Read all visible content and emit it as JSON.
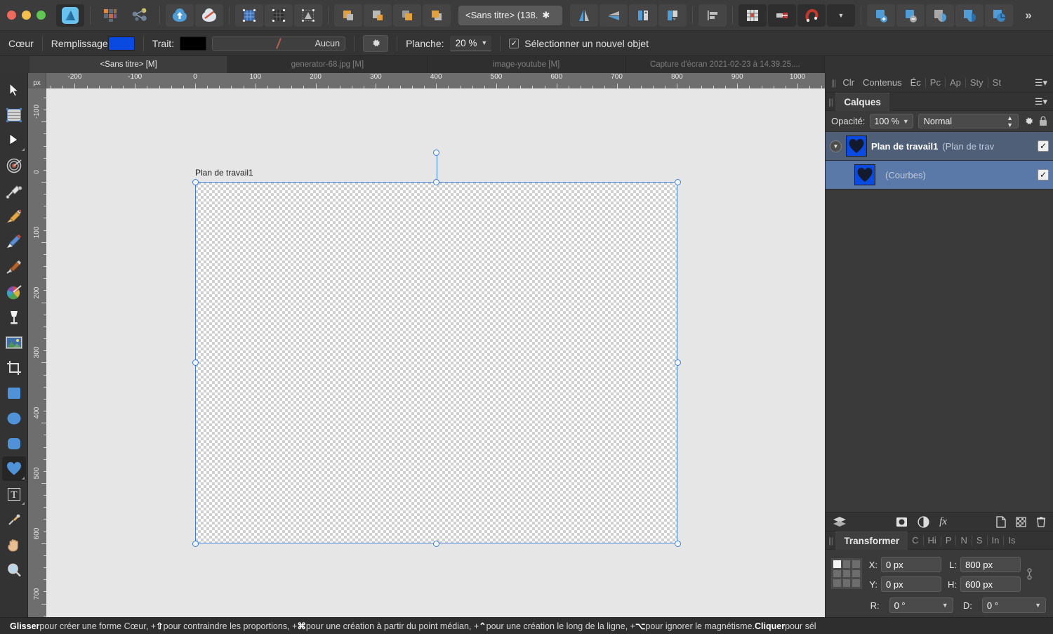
{
  "window": {
    "title": "<Sans titre> (138.",
    "traffic_lights": [
      "close",
      "minimize",
      "zoom"
    ]
  },
  "toolbar": {
    "groups": [
      {
        "name": "app-persona",
        "items": [
          {
            "icon": "affinity-designer-icon",
            "active": true
          }
        ]
      },
      {
        "name": "persona-switch",
        "items": [
          {
            "icon": "pixel-persona-icon"
          },
          {
            "icon": "export-persona-icon"
          }
        ]
      },
      {
        "name": "document",
        "items": [
          {
            "icon": "document-setup-icon"
          },
          {
            "icon": "no-document-icon"
          }
        ]
      },
      {
        "name": "grid",
        "items": [
          {
            "icon": "grid-blue-icon"
          },
          {
            "icon": "grid-dark-icon"
          },
          {
            "icon": "transform-object-icon"
          }
        ]
      },
      {
        "name": "boolean",
        "items": [
          {
            "icon": "add-shapes-icon"
          },
          {
            "icon": "subtract-shapes-icon"
          },
          {
            "icon": "intersect-shapes-icon"
          },
          {
            "icon": "divide-shapes-icon"
          }
        ]
      },
      {
        "name": "flip",
        "items": [
          {
            "icon": "flip-horizontal-icon"
          },
          {
            "icon": "flip-vertical-icon"
          },
          {
            "icon": "rotate-left-icon"
          },
          {
            "icon": "rotate-right-icon"
          }
        ]
      },
      {
        "name": "align",
        "items": [
          {
            "icon": "align-left-icon"
          }
        ]
      },
      {
        "name": "snapping",
        "items": [
          {
            "icon": "show-grid-icon",
            "active": true
          },
          {
            "icon": "snap-guides-icon",
            "active": true
          },
          {
            "icon": "magnet-icon",
            "active": true
          },
          {
            "icon": "chevron-down-icon"
          }
        ]
      },
      {
        "name": "mask",
        "items": [
          {
            "icon": "add-mask-icon"
          },
          {
            "icon": "remove-mask-icon"
          },
          {
            "icon": "adjustment-icon"
          },
          {
            "icon": "pixel-adjust-icon"
          },
          {
            "icon": "live-filter-icon"
          }
        ]
      }
    ],
    "overflow_label": "»"
  },
  "context_bar": {
    "tool_name": "Cœur",
    "fill_label": "Remplissage",
    "fill_color": "#0a4ae0",
    "stroke_label": "Trait:",
    "stroke_color": "#000000",
    "stroke_width_value": "Aucun",
    "settings_icon": "gear-icon",
    "board_label": "Planche:",
    "board_zoom": "20 %",
    "select_new_object_label": "Sélectionner un nouvel objet",
    "select_new_object_checked": true
  },
  "document_tabs": [
    {
      "label": "<Sans titre> [M]",
      "active": true
    },
    {
      "label": "generator-68.jpg [M]",
      "active": false
    },
    {
      "label": "image-youtube [M]",
      "active": false
    },
    {
      "label": "Capture d'écran 2021-02-23 à 14.39.25....",
      "active": false
    }
  ],
  "tools": [
    {
      "name": "move-tool",
      "icon": "⬈",
      "selected": false
    },
    {
      "name": "artboard-tool",
      "icon": "artboard",
      "selected": false
    },
    {
      "name": "node-tool",
      "icon": "▶",
      "selected": false,
      "has_submenu": true
    },
    {
      "name": "corner-tool",
      "icon": "◎",
      "selected": false
    },
    {
      "name": "pen-tool",
      "icon": "pen",
      "selected": false
    },
    {
      "name": "pencil-tool",
      "icon": "fountain-pen",
      "selected": false
    },
    {
      "name": "vector-brush-tool",
      "icon": "pencil",
      "selected": false
    },
    {
      "name": "paint-brush-tool",
      "icon": "brush",
      "selected": false
    },
    {
      "name": "color-wheel-tool",
      "icon": "color-wheel",
      "selected": false
    },
    {
      "name": "fill-tool",
      "icon": "goblet",
      "selected": false
    },
    {
      "name": "place-image-tool",
      "icon": "image",
      "selected": false
    },
    {
      "name": "crop-tool",
      "icon": "crop",
      "selected": false
    },
    {
      "name": "rectangle-tool",
      "icon": "square",
      "selected": false
    },
    {
      "name": "ellipse-tool",
      "icon": "circle",
      "selected": false
    },
    {
      "name": "rounded-rectangle-tool",
      "icon": "rounded-square",
      "selected": false
    },
    {
      "name": "heart-shape-tool",
      "icon": "heart",
      "selected": true,
      "has_submenu": true
    },
    {
      "name": "text-tool",
      "icon": "T",
      "selected": false,
      "has_submenu": true
    },
    {
      "name": "color-picker-tool",
      "icon": "dropper",
      "selected": false
    },
    {
      "name": "hand-tool",
      "icon": "hand",
      "selected": false
    },
    {
      "name": "zoom-tool",
      "icon": "magnifier",
      "selected": false
    }
  ],
  "rulers": {
    "unit": "px",
    "horizontal_labels": [
      -200,
      -100,
      0,
      100,
      200,
      300,
      400,
      500,
      600,
      700,
      800,
      900,
      1000
    ],
    "vertical_labels": [
      -100,
      0,
      100,
      200,
      300,
      400,
      500,
      600,
      700
    ]
  },
  "canvas": {
    "artboard_label": "Plan de travail1",
    "artboard_fill": "#0a4ae0",
    "shape": "heart-cutout",
    "selection_color": "#3d7fd6"
  },
  "right_panel": {
    "tabs": [
      "Clr",
      "Contenus",
      "Éc",
      "Pc",
      "Ap",
      "Sty",
      "St"
    ],
    "panel_title": "Calques",
    "opacity_label": "Opacité:",
    "opacity_value": "100 %",
    "blend_mode": "Normal",
    "gear_icon": "gear-icon",
    "lock_icon": "lock-icon",
    "layers": [
      {
        "name": "Plan de travail1",
        "subtitle": "(Plan de trav",
        "visible": true,
        "selected": true,
        "has_disclosure": true
      },
      {
        "name": "",
        "subtitle": "(Courbes)",
        "visible": true,
        "selected": true,
        "has_disclosure": false
      }
    ],
    "bottom_icons": [
      "layers-stack-icon",
      "mask-icon",
      "adjustment-icon",
      "fx-icon",
      "new-layer-icon",
      "new-pixel-layer-icon",
      "delete-layer-icon"
    ]
  },
  "transform_panel": {
    "tabs": [
      "Transformer",
      "C",
      "Hi",
      "P",
      "N",
      "S",
      "In",
      "Is"
    ],
    "active_tab": "Transformer",
    "fields": {
      "x_label": "X:",
      "x_value": "0 px",
      "y_label": "Y:",
      "y_value": "0 px",
      "w_label": "L:",
      "w_value": "800 px",
      "h_label": "H:",
      "h_value": "600 px",
      "r_label": "R:",
      "r_value": "0 °",
      "d_label": "D:",
      "d_value": "0 °"
    },
    "anchor": "top-left",
    "link_icon": "link-chain-icon"
  },
  "status_bar": {
    "segments": [
      {
        "text": "Glisser",
        "bold": true
      },
      {
        "text": " pour créer une forme Cœur, +",
        "bold": false
      },
      {
        "text": "⇧",
        "bold": true
      },
      {
        "text": " pour contraindre les proportions, +",
        "bold": false
      },
      {
        "text": "⌘",
        "bold": true
      },
      {
        "text": " pour une création à partir du point médian, +",
        "bold": false
      },
      {
        "text": "⌃",
        "bold": true
      },
      {
        "text": " pour une création le long de la ligne, +",
        "bold": false
      },
      {
        "text": "⌥",
        "bold": true
      },
      {
        "text": " pour ignorer le magnétisme. ",
        "bold": false
      },
      {
        "text": "Cliquer",
        "bold": true
      },
      {
        "text": " pour sél",
        "bold": false
      }
    ]
  }
}
